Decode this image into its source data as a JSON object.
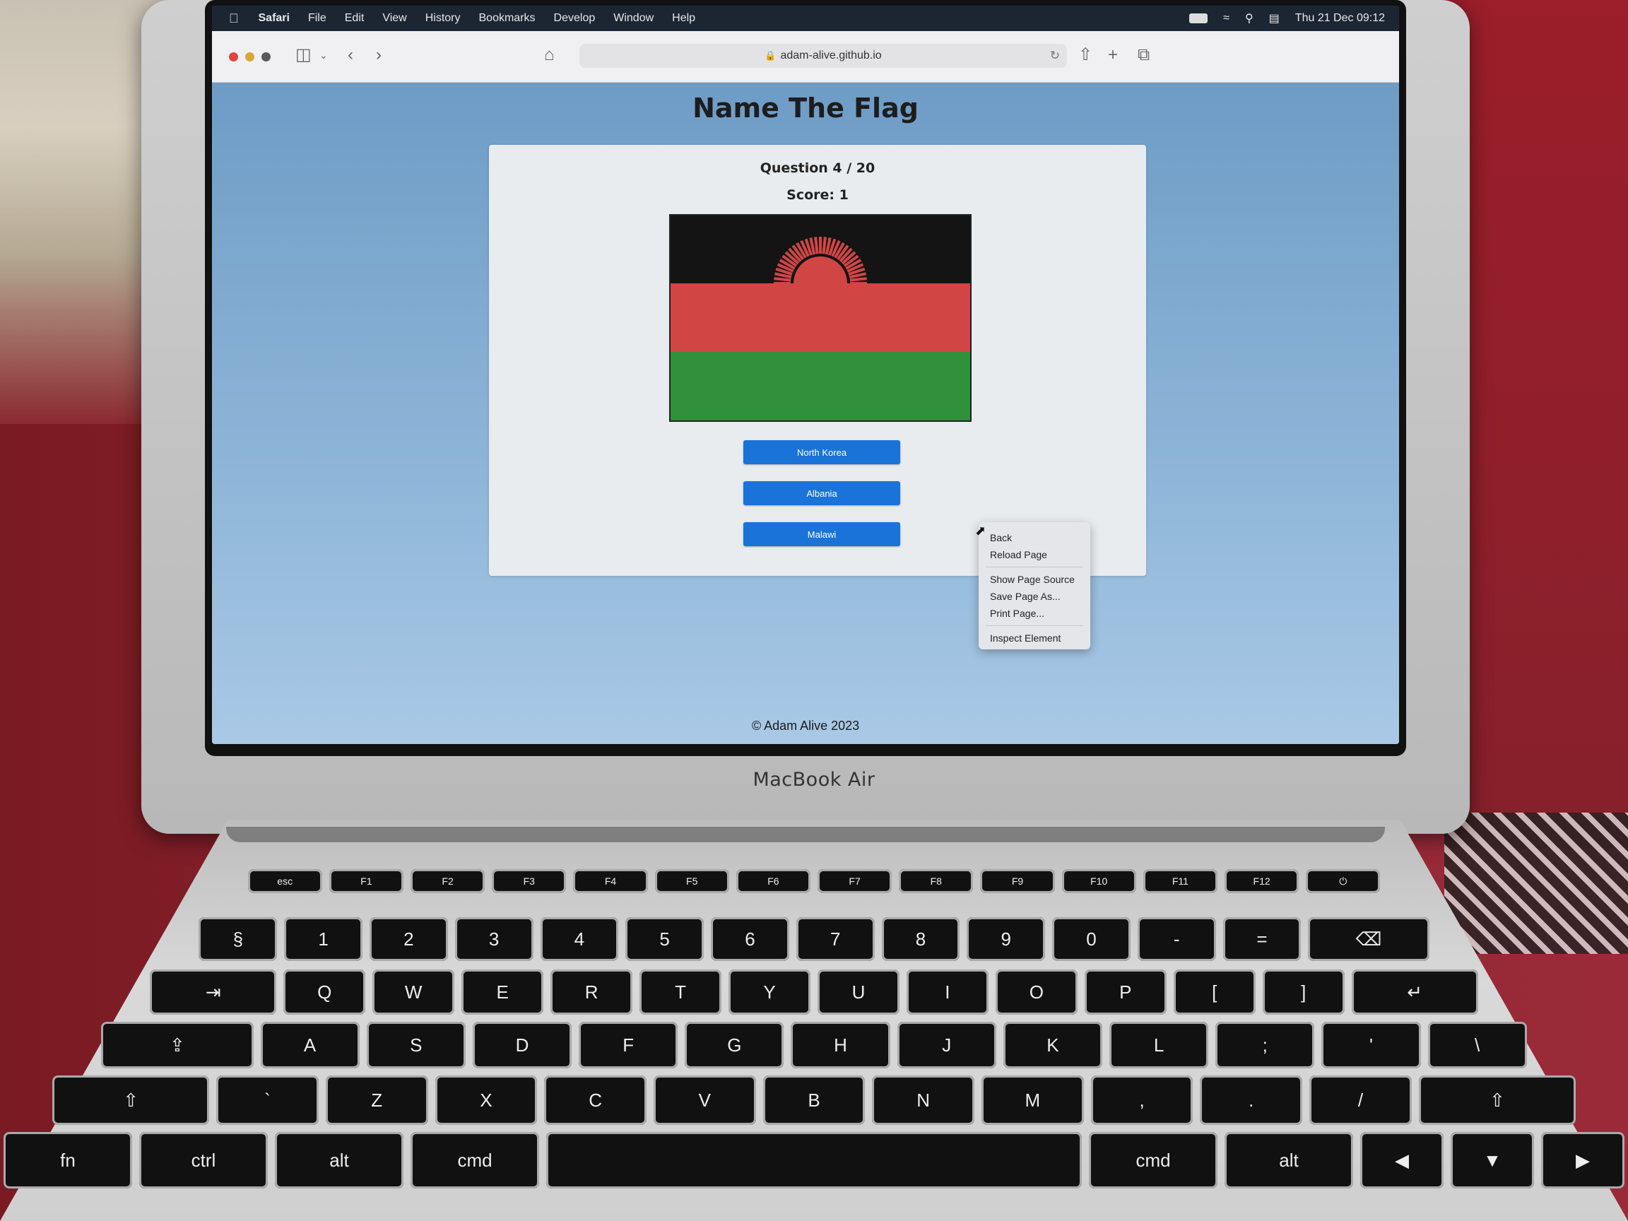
{
  "menubar": {
    "items": [
      "Safari",
      "File",
      "Edit",
      "View",
      "History",
      "Bookmarks",
      "Develop",
      "Window",
      "Help"
    ],
    "datetime": "Thu 21 Dec 09:12"
  },
  "browser": {
    "url": "adam-alive.github.io"
  },
  "page": {
    "title": "Name The Flag",
    "question": "Question 4 / 20",
    "score": "Score: 1",
    "answers": [
      "North Korea",
      "Albania",
      "Malawi"
    ],
    "footer": "© Adam Alive 2023"
  },
  "flag": {
    "stripes": [
      "#141414",
      "#d24545",
      "#2f8f3a"
    ],
    "sun": "#d24545"
  },
  "context_menu": {
    "items": [
      "Back",
      "Reload Page",
      "Show Page Source",
      "Save Page As...",
      "Print Page...",
      "Inspect Element"
    ]
  },
  "laptop": {
    "label": "MacBook Air"
  },
  "keyboard": {
    "rows": [
      [
        "esc",
        "F1",
        "F2",
        "F3",
        "F4",
        "F5",
        "F6",
        "F7",
        "F8",
        "F9",
        "F10",
        "F11",
        "F12",
        "⏻"
      ],
      [
        "§",
        "1",
        "2",
        "3",
        "4",
        "5",
        "6",
        "7",
        "8",
        "9",
        "0",
        "-",
        "=",
        "⌫"
      ],
      [
        "⇥",
        "Q",
        "W",
        "E",
        "R",
        "T",
        "Y",
        "U",
        "I",
        "O",
        "P",
        "[",
        "]",
        "↵"
      ],
      [
        "⇪",
        "A",
        "S",
        "D",
        "F",
        "G",
        "H",
        "J",
        "K",
        "L",
        ";",
        "'",
        "\\"
      ],
      [
        "⇧",
        "`",
        "Z",
        "X",
        "C",
        "V",
        "B",
        "N",
        "M",
        ",",
        ".",
        "/",
        "⇧"
      ],
      [
        "fn",
        "ctrl",
        "alt",
        "cmd",
        "",
        "cmd",
        "alt",
        "◀",
        "▼",
        "▶"
      ]
    ]
  }
}
